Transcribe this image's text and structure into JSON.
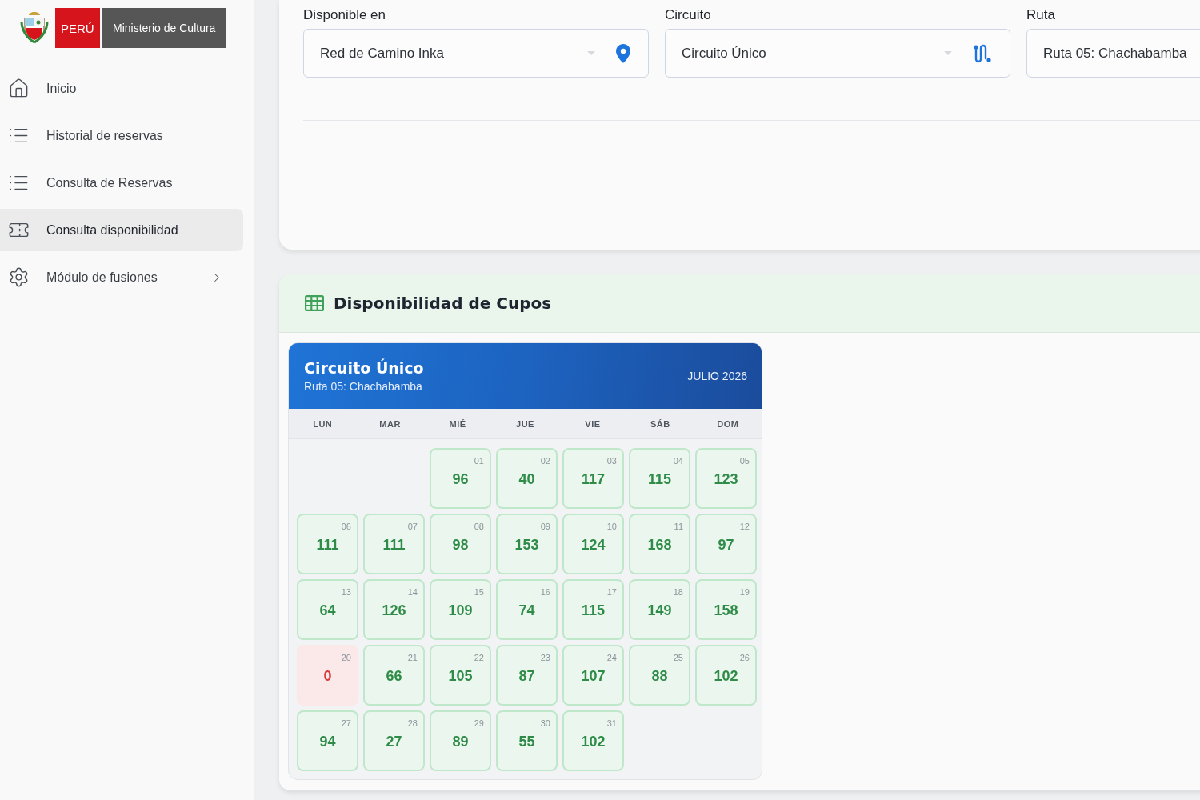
{
  "logo": {
    "country": "PERÚ",
    "ministry": "Ministerio de Cultura"
  },
  "sidebar": {
    "items": [
      {
        "label": "Inicio",
        "kind": "link",
        "selected": false
      },
      {
        "label": "Historial de reservas",
        "kind": "link",
        "selected": false
      },
      {
        "label": "Consulta de Reservas",
        "kind": "link",
        "selected": false
      },
      {
        "label": "Consulta disponibilidad",
        "kind": "link",
        "selected": true
      },
      {
        "label": "Módulo de fusiones",
        "kind": "group",
        "selected": false
      }
    ]
  },
  "filters": [
    {
      "label": "Disponible en",
      "value": "Red de Camino Inka"
    },
    {
      "label": "Circuito",
      "value": "Circuito Único"
    },
    {
      "label": "Ruta",
      "value": "Ruta 05: Chachabamba"
    }
  ],
  "availability": {
    "title": "Disponibilidad de Cupos",
    "calendar": {
      "title": "Circuito Único",
      "subtitle": "Ruta 05: Chachabamba",
      "month": "JULIO 2026",
      "weekdays": [
        "LUN",
        "MAR",
        "MIÉ",
        "JUE",
        "VIE",
        "SÁB",
        "DOM"
      ],
      "days": [
        {
          "kind": "blank"
        },
        {
          "kind": "blank"
        },
        {
          "kind": "available",
          "day": "01",
          "count": "96"
        },
        {
          "kind": "available",
          "day": "02",
          "count": "40"
        },
        {
          "kind": "available",
          "day": "03",
          "count": "117"
        },
        {
          "kind": "available",
          "day": "04",
          "count": "115"
        },
        {
          "kind": "available",
          "day": "05",
          "count": "123"
        },
        {
          "kind": "available",
          "day": "06",
          "count": "111"
        },
        {
          "kind": "available",
          "day": "07",
          "count": "111"
        },
        {
          "kind": "available",
          "day": "08",
          "count": "98"
        },
        {
          "kind": "available",
          "day": "09",
          "count": "153"
        },
        {
          "kind": "available",
          "day": "10",
          "count": "124"
        },
        {
          "kind": "available",
          "day": "11",
          "count": "168"
        },
        {
          "kind": "available",
          "day": "12",
          "count": "97"
        },
        {
          "kind": "available",
          "day": "13",
          "count": "64"
        },
        {
          "kind": "available",
          "day": "14",
          "count": "126"
        },
        {
          "kind": "available",
          "day": "15",
          "count": "109"
        },
        {
          "kind": "available",
          "day": "16",
          "count": "74"
        },
        {
          "kind": "available",
          "day": "17",
          "count": "115"
        },
        {
          "kind": "available",
          "day": "18",
          "count": "149"
        },
        {
          "kind": "available",
          "day": "19",
          "count": "158"
        },
        {
          "kind": "sold_out",
          "day": "20",
          "count": "0"
        },
        {
          "kind": "available",
          "day": "21",
          "count": "66"
        },
        {
          "kind": "available",
          "day": "22",
          "count": "105"
        },
        {
          "kind": "available",
          "day": "23",
          "count": "87"
        },
        {
          "kind": "available",
          "day": "24",
          "count": "107"
        },
        {
          "kind": "available",
          "day": "25",
          "count": "88"
        },
        {
          "kind": "available",
          "day": "26",
          "count": "102"
        },
        {
          "kind": "available",
          "day": "27",
          "count": "94"
        },
        {
          "kind": "available",
          "day": "28",
          "count": "27"
        },
        {
          "kind": "available",
          "day": "29",
          "count": "89"
        },
        {
          "kind": "available",
          "day": "30",
          "count": "55"
        },
        {
          "kind": "available",
          "day": "31",
          "count": "102"
        }
      ]
    }
  }
}
